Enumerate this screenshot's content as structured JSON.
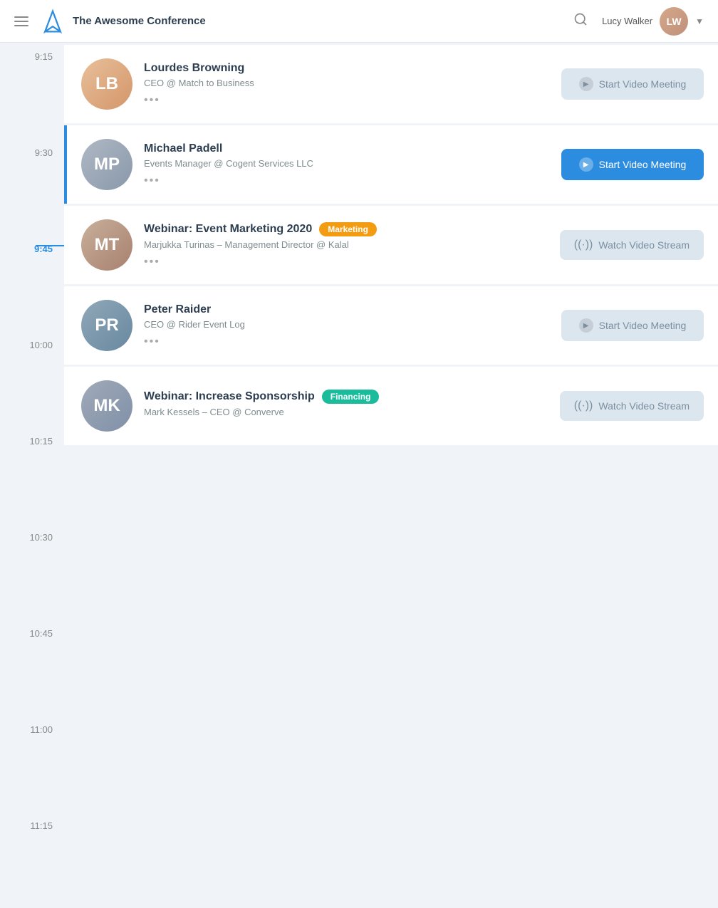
{
  "header": {
    "title": "The Awesome Conference",
    "logo_alt": "The Awesome Conference Logo",
    "user": {
      "name": "Lucy",
      "surname": "Walker",
      "full_name": "Lucy Walker"
    },
    "search_icon": "search-icon",
    "dropdown_icon": "chevron-down-icon"
  },
  "timeline": [
    {
      "time": "9:15",
      "active": false
    },
    {
      "time": "9:30",
      "active": false
    },
    {
      "time": "9:45",
      "active": true
    },
    {
      "time": "10:00",
      "active": false
    },
    {
      "time": "10:15",
      "active": false
    },
    {
      "time": "10:30",
      "active": false
    },
    {
      "time": "10:45",
      "active": false
    },
    {
      "time": "11:00",
      "active": false
    },
    {
      "time": "11:15",
      "active": false
    }
  ],
  "schedule": [
    {
      "id": 1,
      "name": "Lourdes Browning",
      "title": "CEO @ Match to Business",
      "button_label": "Start Video Meeting",
      "button_type": "secondary",
      "badge": null,
      "avatar_color": "av-1",
      "avatar_initials": "LB"
    },
    {
      "id": 2,
      "name": "Michael Padell",
      "title": "Events Manager @ Cogent Services LLC",
      "button_label": "Start Video Meeting",
      "button_type": "primary",
      "badge": null,
      "avatar_color": "av-2",
      "avatar_initials": "MP"
    },
    {
      "id": 3,
      "name": "Webinar: Event Marketing 2020",
      "title": "Marjukka Turinas – Management Director @ Kalal",
      "button_label": "Watch Video Stream",
      "button_type": "stream",
      "badge": "Marketing",
      "badge_type": "marketing",
      "avatar_color": "av-3",
      "avatar_initials": "MT"
    },
    {
      "id": 4,
      "name": "Peter Raider",
      "title": "CEO @  Rider Event Log",
      "button_label": "Start Video Meeting",
      "button_type": "secondary",
      "badge": null,
      "avatar_color": "av-4",
      "avatar_initials": "PR"
    },
    {
      "id": 5,
      "name": "Webinar: Increase Sponsorship",
      "title": "Mark Kessels – CEO @ Converve",
      "button_label": "Watch Video Stream",
      "button_type": "stream",
      "badge": "Financing",
      "badge_type": "financing",
      "avatar_color": "av-5",
      "avatar_initials": "MK"
    }
  ],
  "labels": {
    "dots": "•••"
  }
}
